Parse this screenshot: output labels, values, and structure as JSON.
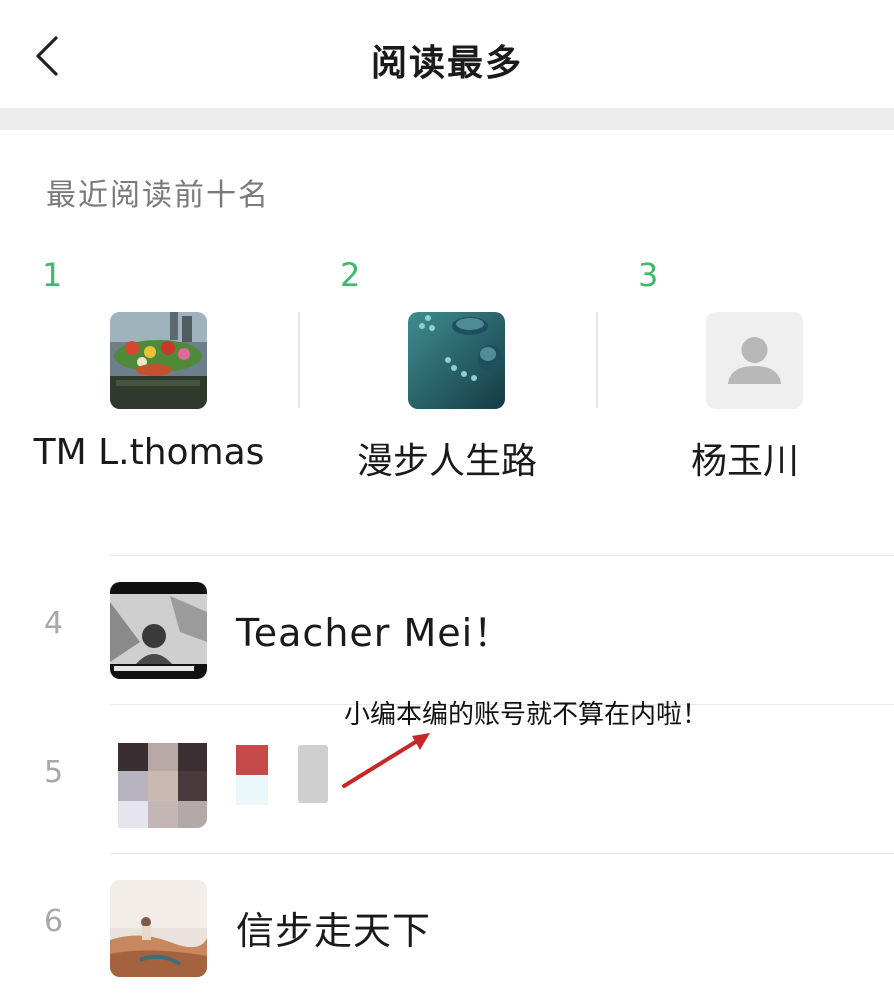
{
  "header": {
    "title": "阅读最多",
    "back_icon": "chevron-left-icon"
  },
  "section": {
    "label": "最近阅读前十名"
  },
  "top3": [
    {
      "rank": "1",
      "name": "TM L.thomas",
      "avatar": "photo-avatar"
    },
    {
      "rank": "2",
      "name": "漫步人生路",
      "avatar": "photo-avatar"
    },
    {
      "rank": "3",
      "name": "杨玉川",
      "avatar": "default-person-icon"
    }
  ],
  "list": [
    {
      "rank": "4",
      "name": "Teacher Mei！",
      "avatar": "photo-avatar"
    },
    {
      "rank": "5",
      "name": "",
      "avatar": "pixelated-avatar",
      "redacted": true
    },
    {
      "rank": "6",
      "name": "信步走天下",
      "avatar": "photo-avatar"
    }
  ],
  "annotation": {
    "text": "小编本编的账号就不算在内啦！",
    "arrow_color": "#c62828"
  },
  "colors": {
    "accent_rank": "#3fb96a",
    "muted_rank": "#a8a8a8",
    "band": "#ededed"
  }
}
